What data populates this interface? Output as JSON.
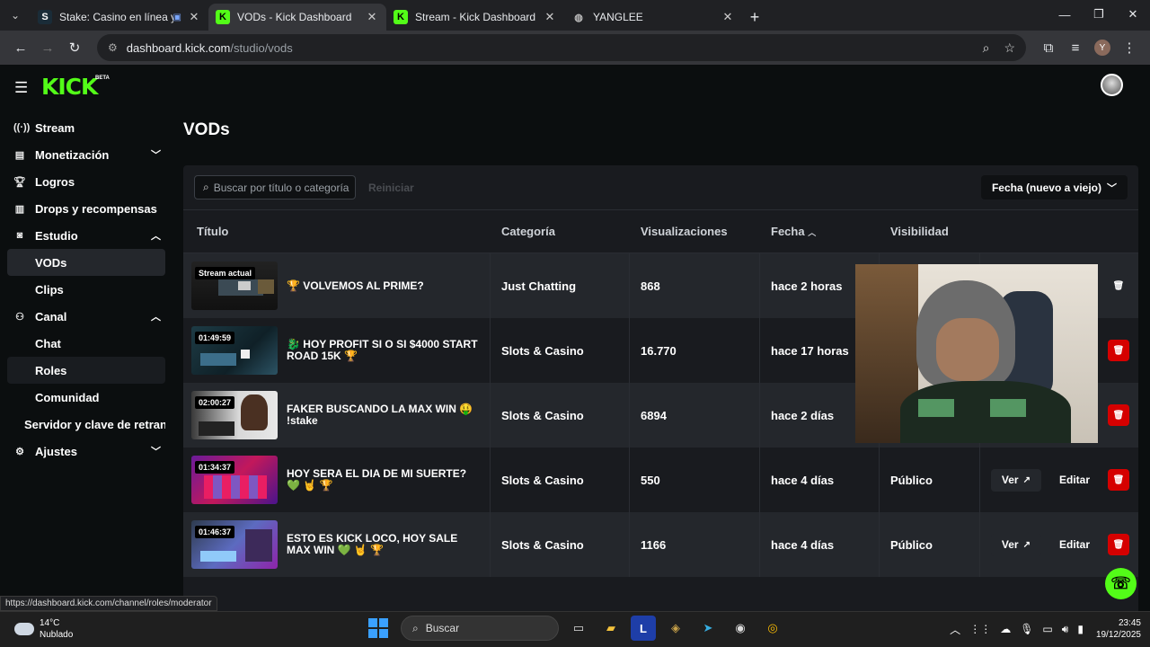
{
  "browser": {
    "tabs": [
      {
        "title": "Stake: Casino en línea y Ap",
        "favicon": "S",
        "fav_color": "#1a2c38",
        "active": false
      },
      {
        "title": "VODs - Kick Dashboard",
        "favicon": "K",
        "fav_color": "#53fc18",
        "active": true
      },
      {
        "title": "Stream - Kick Dashboard",
        "favicon": "K",
        "fav_color": "#53fc18",
        "active": false
      },
      {
        "title": "YANGLEE",
        "favicon": "◍",
        "fav_color": "#5f6368",
        "active": false
      }
    ],
    "url_domain": "dashboard.kick.com",
    "url_path": "/studio/vods",
    "profile_initial": "Y"
  },
  "app": {
    "logo": "KICK",
    "logo_badge": "BETA",
    "page_title": "VODs",
    "accent_color": "#53fc18",
    "danger_color": "#d50000"
  },
  "sidebar": {
    "stream": "Stream",
    "monetizacion": "Monetización",
    "logros": "Logros",
    "drops": "Drops y recompensas",
    "estudio": "Estudio",
    "vods": "VODs",
    "clips": "Clips",
    "canal": "Canal",
    "chat": "Chat",
    "roles": "Roles",
    "comunidad": "Comunidad",
    "servidor": "Servidor y clave de retransmisión",
    "ajustes": "Ajustes"
  },
  "filters": {
    "search_placeholder": "Buscar por título o categoría",
    "reset": "Reiniciar",
    "sort": "Fecha (nuevo a viejo)"
  },
  "table": {
    "headers": {
      "title": "Título",
      "category": "Categoría",
      "views": "Visualizaciones",
      "date": "Fecha",
      "visibility": "Visibilidad"
    },
    "actions": {
      "view": "Ver",
      "edit": "Editar"
    },
    "rows": [
      {
        "badge": "Stream actual",
        "title": "🏆 VOLVEMOS AL PRIME?",
        "category": "Just Chatting",
        "views": "868",
        "date": "hace 2 horas",
        "visibility": ""
      },
      {
        "badge": "01:49:59",
        "title": "🐉 HOY PROFIT SI O SI $4000 START ROAD 15K 🏆",
        "category": "Slots & Casino",
        "views": "16.770",
        "date": "hace 17 horas",
        "visibility": ""
      },
      {
        "badge": "02:00:27",
        "title": "FAKER BUSCANDO LA MAX WIN 🤑 !stake",
        "category": "Slots & Casino",
        "views": "6894",
        "date": "hace 2 días",
        "visibility": ""
      },
      {
        "badge": "01:34:37",
        "title": "HOY SERA EL DIA DE MI SUERTE? 💚 🤘 🏆",
        "category": "Slots & Casino",
        "views": "550",
        "date": "hace 4 días",
        "visibility": "Público"
      },
      {
        "badge": "01:46:37",
        "title": "ESTO ES KICK LOCO, HOY SALE MAX WIN 💚 🤘 🏆",
        "category": "Slots & Casino",
        "views": "1166",
        "date": "hace 4 días",
        "visibility": "Público"
      }
    ]
  },
  "status_bar_url": "https://dashboard.kick.com/channel/roles/moderator",
  "taskbar": {
    "temp": "14°C",
    "weather": "Nublado",
    "search": "Buscar",
    "time": "23:45",
    "date": "19/12/2025"
  }
}
